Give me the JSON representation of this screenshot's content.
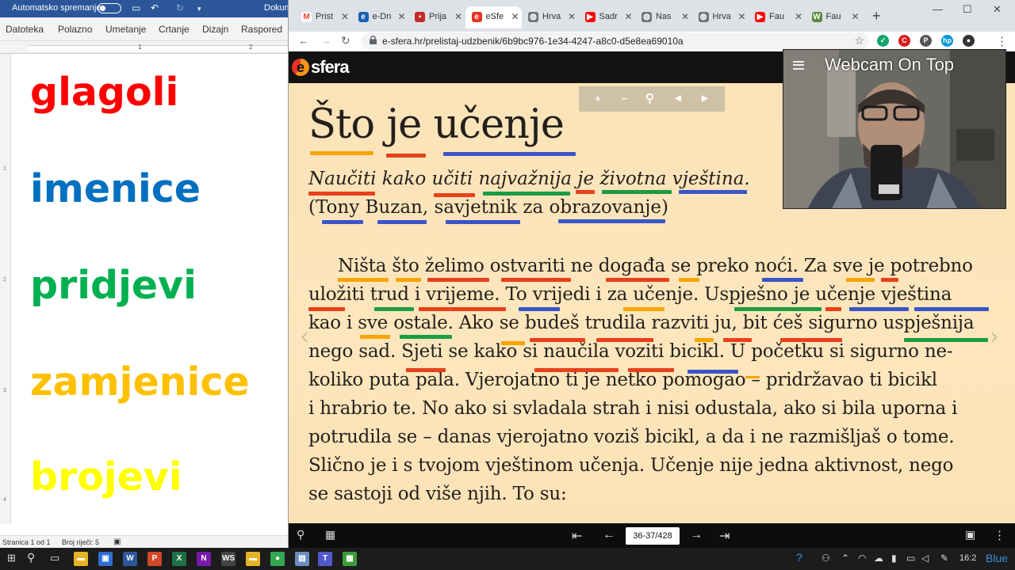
{
  "word": {
    "autosave_label": "Automatsko spremanje",
    "doc_title": "Dokum",
    "ribbon_tabs": [
      "Datoteka",
      "Polazno",
      "Umetanje",
      "Crtanje",
      "Dizajn",
      "Raspored"
    ],
    "ruler_marks": [
      "1",
      "2"
    ],
    "vruler_marks": [
      "1",
      "2",
      "3",
      "4"
    ],
    "word_classes": [
      {
        "text": "glagoli",
        "color": "#ff0000"
      },
      {
        "text": "imenice",
        "color": "#0070c0"
      },
      {
        "text": "pridjevi",
        "color": "#00b050"
      },
      {
        "text": "zamjenice",
        "color": "#ffc000"
      },
      {
        "text": "brojevi",
        "color": "#ffff00"
      }
    ],
    "status": {
      "page": "Stranica 1 od 1",
      "words": "Broj riječi: 5"
    }
  },
  "browser": {
    "tabs": [
      {
        "label": "Prist",
        "icon": "gmail-icon",
        "color": "#ffffff",
        "glyph": "M"
      },
      {
        "label": "e-Dn",
        "icon": "edn-icon",
        "color": "#1a5fb4",
        "glyph": "e"
      },
      {
        "label": "Prija",
        "icon": "gift-icon",
        "color": "#c62828",
        "glyph": "▪"
      },
      {
        "label": "eSfe",
        "icon": "esfera-icon",
        "color": "#e63323",
        "glyph": "e",
        "active": true
      },
      {
        "label": "Hrva",
        "icon": "globe-icon",
        "color": "#70757a",
        "glyph": "◍"
      },
      {
        "label": "Sadr",
        "icon": "youtube-icon",
        "color": "#ff0000",
        "glyph": "▶"
      },
      {
        "label": "Nas",
        "icon": "globe-icon",
        "color": "#70757a",
        "glyph": "◍"
      },
      {
        "label": "Hrva",
        "icon": "globe-icon",
        "color": "#70757a",
        "glyph": "◍"
      },
      {
        "label": "Fau",
        "icon": "youtube-icon",
        "color": "#ff0000",
        "glyph": "▶"
      },
      {
        "label": "Fau",
        "icon": "wiki-icon",
        "color": "#5b8a3a",
        "glyph": "W"
      }
    ],
    "url": "e-sfera.hr/prelistaj-udzbenik/6b9bc976-1e34-4247-a8c0-d5e8ea69010a",
    "extensions": [
      {
        "name": "grammarly-icon",
        "color": "#15a46b",
        "glyph": "✓"
      },
      {
        "name": "red-extension-icon",
        "color": "#d81b1b",
        "glyph": "C"
      },
      {
        "name": "pinterest-icon",
        "color": "#555555",
        "glyph": "P"
      },
      {
        "name": "hp-icon",
        "color": "#0096d6",
        "glyph": "hp"
      },
      {
        "name": "profile-avatar-icon",
        "color": "#333333",
        "glyph": "●"
      }
    ]
  },
  "esfera": {
    "logo_text": "sfera",
    "page_indicator": "36-37/428",
    "book": {
      "title": "Što je učenje",
      "quote": "Naučiti kako učiti najvažnija je životna vještina.",
      "author": "(Tony Buzan, savjetnik za obrazovanje)",
      "lines": [
        "Ništa što želimo ostvariti ne događa se preko noći. Za sve je potrebno",
        "uložiti trud i vrijeme. To vrijedi i za učenje. Uspješno je učenje vještina",
        "kao i sve ostale. Ako se budeš trudila razviti ju, bit ćeš sigurno uspješnija",
        "nego sad. Sjeti se kako si naučila voziti bicikl. U početku si sigurno ne-",
        "koliko puta pala. Vjerojatno ti je netko pomogao – pridržavao ti bicikl",
        "i hrabrio te. No ako si svladala strah i nisi odustala, ako si bila uporna i",
        "potrudila se – danas vjerojatno voziš bicikl, a da i ne razmišljaš o tome.",
        "Slično je i s tvojom vještinom učenja. Učenje nije jedna aktivnost, nego",
        "se sastoji od više njih. To su:"
      ]
    },
    "underline_colors": {
      "orange": "#f5a500",
      "red": "#e8401c",
      "blue": "#3a55c9",
      "green": "#199c46"
    }
  },
  "webcam": {
    "title": "Webcam On Top"
  },
  "taskbar": {
    "apps": [
      {
        "name": "file-explorer-icon",
        "color": "#e6b324",
        "glyph": "▬"
      },
      {
        "name": "store-icon",
        "color": "#2f6fd1",
        "glyph": "▣"
      },
      {
        "name": "word-icon",
        "color": "#2b579a",
        "glyph": "W"
      },
      {
        "name": "powerpoint-icon",
        "color": "#d24726",
        "glyph": "P"
      },
      {
        "name": "excel-icon",
        "color": "#1e7145",
        "glyph": "X"
      },
      {
        "name": "onenote-icon",
        "color": "#7719aa",
        "glyph": "N"
      },
      {
        "name": "ws-icon",
        "color": "#444444",
        "glyph": "WS"
      },
      {
        "name": "folder-icon",
        "color": "#e6b324",
        "glyph": "▬"
      },
      {
        "name": "chrome-icon",
        "color": "#34a853",
        "glyph": "●"
      },
      {
        "name": "notepad-icon",
        "color": "#6c8ebf",
        "glyph": "▤"
      },
      {
        "name": "teams-icon",
        "color": "#5059c9",
        "glyph": "T"
      },
      {
        "name": "green-app-icon",
        "color": "#3a9b3a",
        "glyph": "▦"
      }
    ],
    "clock": "16:2",
    "lang": "Blue"
  }
}
